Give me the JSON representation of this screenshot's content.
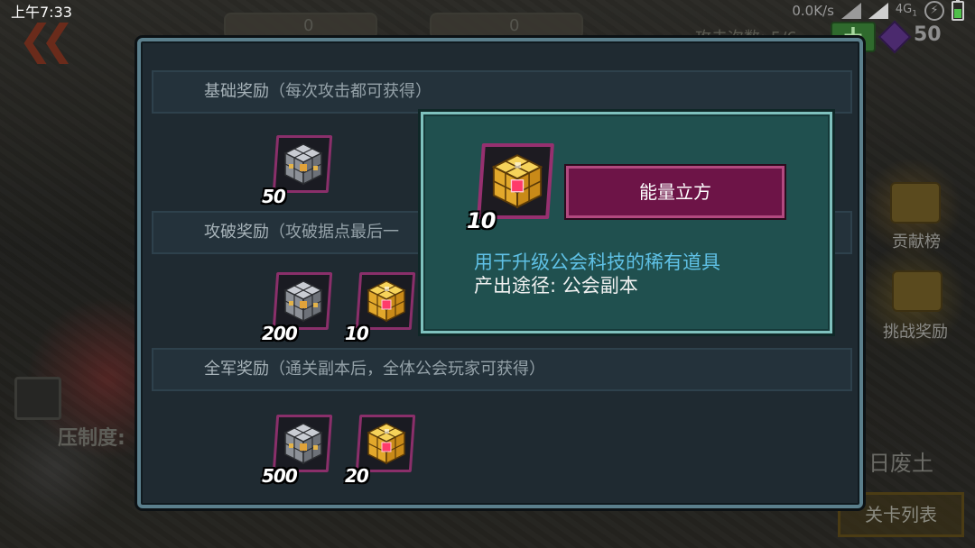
{
  "status_bar": {
    "time": "上午7:33",
    "net_speed": "0.0K/s",
    "net_type": "4G",
    "net_sub": "1"
  },
  "background": {
    "attack_count_text": "攻击次数: 5/6",
    "gem_count": "50",
    "side_ranking_label": "贡献榜",
    "side_challenge_label": "挑战奖励",
    "suppression_label": "压制度:",
    "area_name": "日废土",
    "level_list_button": "关卡列表",
    "top_slot_values": [
      "0",
      "0"
    ]
  },
  "rewards": {
    "sections": [
      {
        "title": "基础奖励",
        "hint": "（每次攻击都可获得）",
        "items": [
          {
            "icon": "gray-cube-icon",
            "count": "50"
          }
        ]
      },
      {
        "title": "攻破奖励",
        "hint": "（攻破据点最后一",
        "items": [
          {
            "icon": "gray-cube-icon",
            "count": "200"
          },
          {
            "icon": "gold-cube-icon",
            "count": "10"
          }
        ]
      },
      {
        "title": "全军奖励",
        "hint": "（通关副本后，全体公会玩家可获得）",
        "items": [
          {
            "icon": "gray-cube-icon",
            "count": "500"
          },
          {
            "icon": "gold-cube-icon",
            "count": "20"
          }
        ]
      }
    ]
  },
  "tooltip": {
    "item_name": "能量立方",
    "item_count": "10",
    "item_icon": "gold-cube-icon",
    "description": "用于升级公会科技的稀有道具",
    "source": "产出途径: 公会副本"
  },
  "colors": {
    "panel_border": "#5b7f8c",
    "tooltip_bg": "#20504f",
    "tooltip_border": "#7fc1be",
    "name_plate": "#6d1447",
    "frame_magenta": "#8a2f6a",
    "desc_blue": "#5fc1e6"
  }
}
